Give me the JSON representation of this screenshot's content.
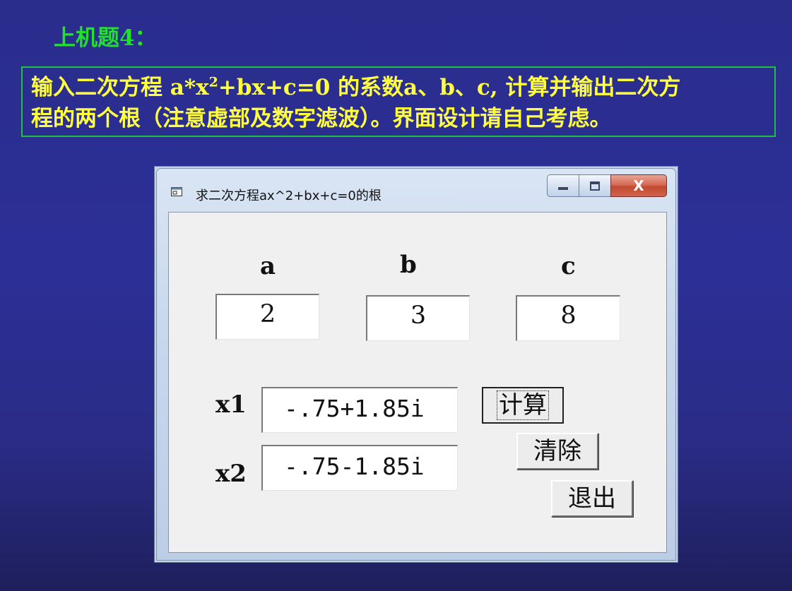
{
  "slide": {
    "title": "上机题4：",
    "task_line_1_pre": "输入二次方程  a*x",
    "task_line_1_sup": "2",
    "task_line_1_post": "+bx+c=0  的系数a、b、c, 计算并输出二次方",
    "task_line_2": "程的两个根（注意虚部及数字滤波）。界面设计请自己考虑。"
  },
  "window": {
    "title": "求二次方程ax^2+bx+c=0的根",
    "close_glyph": "X",
    "labels": {
      "a": "a",
      "b": "b",
      "c": "c",
      "x1": "x1",
      "x2": "x2"
    },
    "inputs": {
      "a": "2",
      "b": "3",
      "c": "8"
    },
    "results": {
      "x1": "-.75+1.85i",
      "x2": "-.75-1.85i"
    },
    "buttons": {
      "compute": "计算",
      "clear": "清除",
      "exit": "退出"
    }
  },
  "colors": {
    "slide_background": "#2c2f96",
    "slide_title": "#22e02c",
    "task_text": "#ffff40",
    "task_border": "#20c040",
    "close_button": "#d0634c"
  }
}
